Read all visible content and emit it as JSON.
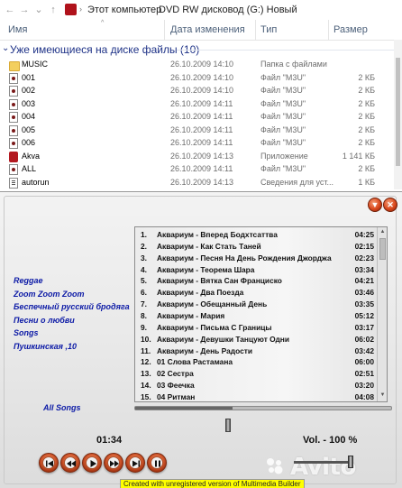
{
  "explorer": {
    "breadcrumb": [
      "Этот компьютер",
      "DVD RW дисковод (G:) Новый"
    ],
    "columns": {
      "name": "Имя",
      "date": "Дата изменения",
      "type": "Тип",
      "size": "Размер"
    },
    "group_label": "Уже имеющиеся на диске файлы (10)",
    "files": [
      {
        "name": "MUSIC",
        "date": "26.10.2009 14:10",
        "type": "Папка с файлами",
        "size": "",
        "icon": "folder-icon"
      },
      {
        "name": "001",
        "date": "26.10.2009 14:10",
        "type": "Файл \"M3U\"",
        "size": "2 КБ",
        "icon": "m3u-file-icon"
      },
      {
        "name": "002",
        "date": "26.10.2009 14:10",
        "type": "Файл \"M3U\"",
        "size": "2 КБ",
        "icon": "m3u-file-icon"
      },
      {
        "name": "003",
        "date": "26.10.2009 14:11",
        "type": "Файл \"M3U\"",
        "size": "2 КБ",
        "icon": "m3u-file-icon"
      },
      {
        "name": "004",
        "date": "26.10.2009 14:11",
        "type": "Файл \"M3U\"",
        "size": "2 КБ",
        "icon": "m3u-file-icon"
      },
      {
        "name": "005",
        "date": "26.10.2009 14:11",
        "type": "Файл \"M3U\"",
        "size": "2 КБ",
        "icon": "m3u-file-icon"
      },
      {
        "name": "006",
        "date": "26.10.2009 14:11",
        "type": "Файл \"M3U\"",
        "size": "2 КБ",
        "icon": "m3u-file-icon"
      },
      {
        "name": "Akva",
        "date": "26.10.2009 14:13",
        "type": "Приложение",
        "size": "1 141 КБ",
        "icon": "app-icon"
      },
      {
        "name": "ALL",
        "date": "26.10.2009 14:11",
        "type": "Файл \"M3U\"",
        "size": "2 КБ",
        "icon": "m3u-file-icon"
      },
      {
        "name": "autorun",
        "date": "26.10.2009 14:13",
        "type": "Сведения для уст...",
        "size": "1 КБ",
        "icon": "setup-info-icon"
      }
    ]
  },
  "player": {
    "playlists": [
      "Reggae",
      "Zoom Zoom Zoom",
      "Беспечный русский бродяга",
      "Песни о любви",
      "Songs",
      "Пушкинская ,10"
    ],
    "all_songs": "All Songs",
    "tracks": [
      {
        "no": "1.",
        "title": "Аквариум - Вперед Бодхтсаттва",
        "dur": "04:25"
      },
      {
        "no": "2.",
        "title": "Аквариум - Как Стать Таней",
        "dur": "02:15"
      },
      {
        "no": "3.",
        "title": "Аквариум - Песня На День Рождения Джорджа",
        "dur": "02:23"
      },
      {
        "no": "4.",
        "title": "Аквариум - Теорема Шара",
        "dur": "03:34"
      },
      {
        "no": "5.",
        "title": "Аквариум - Вятка Сан Франциско",
        "dur": "04:21"
      },
      {
        "no": "6.",
        "title": "Аквариум - Два Поезда",
        "dur": "03:46"
      },
      {
        "no": "7.",
        "title": "Аквариум - Обещанный День",
        "dur": "03:35"
      },
      {
        "no": "8.",
        "title": "Аквариум - Мария",
        "dur": "05:12"
      },
      {
        "no": "9.",
        "title": "Аквариум - Письма С Границы",
        "dur": "03:17"
      },
      {
        "no": "10.",
        "title": "Аквариум - Девушки Танцуют Одни",
        "dur": "06:02"
      },
      {
        "no": "11.",
        "title": "Аквариум - День Радости",
        "dur": "03:42"
      },
      {
        "no": "12.",
        "title": "01 Слова Растамана",
        "dur": "06:00"
      },
      {
        "no": "13.",
        "title": "02 Сестра",
        "dur": "02:51"
      },
      {
        "no": "14.",
        "title": "03 Феечка",
        "dur": "03:20"
      },
      {
        "no": "15.",
        "title": "04 Ритман",
        "dur": "04:08"
      }
    ],
    "time": "01:34",
    "volume_label": "Vol. - 100 %",
    "volume": 1.0,
    "progress": 0.38,
    "banner": "Created with unregistered version of Multimedia Builder",
    "minimize_glyph": "▼",
    "close_glyph": "✕"
  },
  "watermark": "Avito",
  "colors": {
    "playlist_link": "#0c1aa6",
    "button_orange": "#d35a2e",
    "group_header": "#1e3287"
  }
}
